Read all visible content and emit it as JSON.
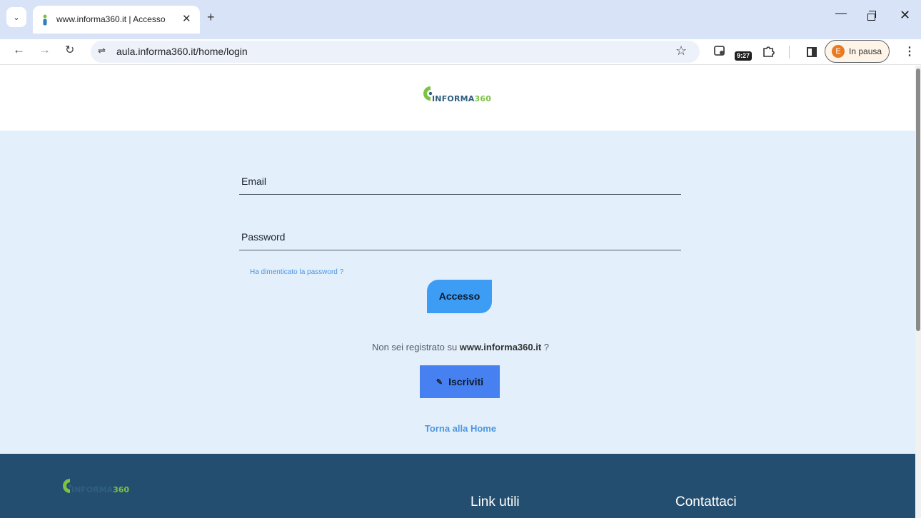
{
  "browser": {
    "tab": {
      "title": "www.informa360.it | Accesso"
    },
    "url": "aula.informa360.it/home/login",
    "extension_badge": "9:27",
    "profile": {
      "initial": "E",
      "status": "In pausa"
    }
  },
  "header": {
    "logo": {
      "prefix": "INFORMA",
      "suffix": "360"
    }
  },
  "login": {
    "email_label": "Email",
    "password_label": "Password",
    "forgot_link": "Ha dimenticato la password ?",
    "submit_label": "Accesso",
    "register_prompt_before": "Non sei registrato su ",
    "register_site": "www.informa360.it",
    "register_prompt_after": " ?",
    "register_button": "Iscriviti",
    "home_link": "Torna alla Home"
  },
  "footer": {
    "logo": {
      "prefix": "INFORMA",
      "suffix": "360"
    },
    "links_title": "Link utili",
    "contact_title": "Contattaci"
  },
  "colors": {
    "tabbar_bg": "#d8e3f7",
    "login_bg": "#e3f0fc",
    "primary_button": "#3d9cf4",
    "secondary_button": "#4780f0",
    "link": "#4d94df",
    "footer_bg": "#244e6f",
    "logo_green": "#7cc243",
    "logo_blue": "#2f5f7f"
  }
}
